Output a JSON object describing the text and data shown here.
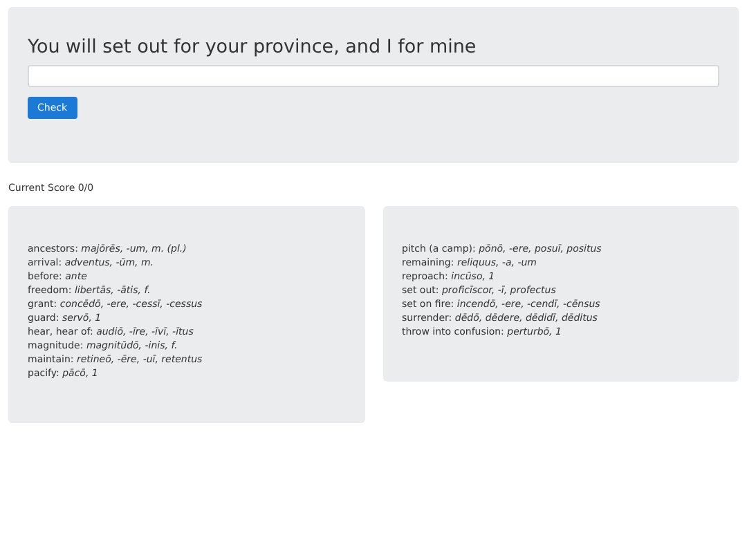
{
  "prompt": {
    "sentence": "You will set out for your province, and I for mine",
    "check_button": "Check"
  },
  "score": "Current Score 0/0",
  "vocab_panels": [
    {
      "entries": [
        {
          "english": "ancestors:",
          "latin": "majōrēs, -um, m. (pl.)"
        },
        {
          "english": "arrival:",
          "latin": "adventus, -ūm, m."
        },
        {
          "english": "before:",
          "latin": "ante"
        },
        {
          "english": "freedom:",
          "latin": "libertās, -ātis, f."
        },
        {
          "english": "grant:",
          "latin": "concēdō, -ere, -cessī, -cessus"
        },
        {
          "english": "guard:",
          "latin": "servō, 1"
        },
        {
          "english": "hear, hear of:",
          "latin": "audiō, -īre, -īvī, -ītus"
        },
        {
          "english": "magnitude:",
          "latin": "magnitūdō, -inis, f."
        },
        {
          "english": "maintain:",
          "latin": "retineō, -ēre, -uī, retentus"
        },
        {
          "english": "pacify:",
          "latin": "pācō, 1"
        }
      ]
    },
    {
      "entries": [
        {
          "english": "pitch (a camp):",
          "latin": "pōnō, -ere, posuī, positus"
        },
        {
          "english": "remaining:",
          "latin": "reliquus, -a, -um"
        },
        {
          "english": "reproach:",
          "latin": "incūso, 1"
        },
        {
          "english": "set out:",
          "latin": "proficīscor, -ī, profectus"
        },
        {
          "english": "set on fire:",
          "latin": "incendō, -ere, -cendī, -cēnsus"
        },
        {
          "english": "surrender:",
          "latin": "dēdō, dēdere, dēdidī, dēditus"
        },
        {
          "english": "throw into confusion:",
          "latin": "perturbō, 1"
        }
      ]
    }
  ]
}
